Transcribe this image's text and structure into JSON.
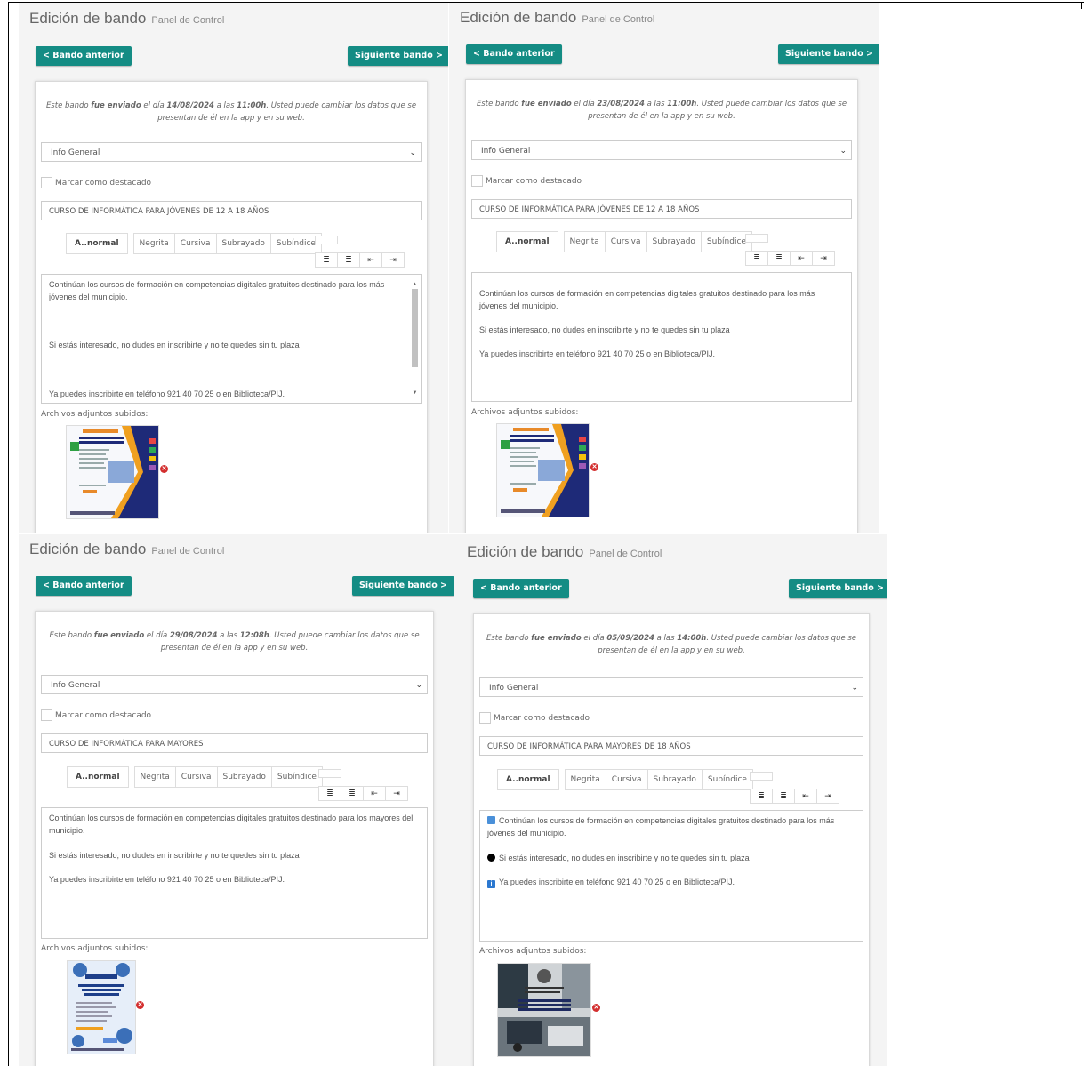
{
  "panels": [
    {
      "title": "Edición de bando",
      "subtitle": "Panel de Control",
      "prev_label": "< Bando anterior",
      "next_label": "Siguiente bando >",
      "notice_pre": "Este bando ",
      "notice_sent": "fue enviado",
      "notice_mid": " el día ",
      "notice_date": "14/08/2024",
      "notice_mid2": " a las ",
      "notice_time": "11:00h",
      "notice_post": ". Usted puede cambiar los datos que se presentan de él en la app y en su web.",
      "category": "Info General",
      "featured_label": "Marcar como destacado",
      "bando_title": "CURSO DE INFORMÁTICA PARA JÓVENES DE 12 A 18 AÑOS",
      "toolbar": {
        "font": "A..normal",
        "bold": "Negrita",
        "italic": "Cursiva",
        "underline": "Subrayado",
        "subscript": "Subíndice"
      },
      "body": [
        "Continúan los cursos de formación en competencias digitales gratuitos destinado para los más jóvenes del municipio.",
        "Si estás interesado, no dudes en inscribirte y no te quedes sin tu plaza",
        "Ya puedes inscribirte en teléfono 921 40 70 25 o en Biblioteca/PIJ."
      ],
      "attachments_label": "Archivos adjuntos subidos:",
      "poster_heading": "NUEVO CENTRO DE CAPACITACIÓN DIGITAL"
    },
    {
      "title": "Edición de bando",
      "subtitle": "Panel de Control",
      "prev_label": "< Bando anterior",
      "next_label": "Siguiente bando >",
      "notice_pre": "Este bando ",
      "notice_sent": "fue enviado",
      "notice_mid": " el día ",
      "notice_date": "23/08/2024",
      "notice_mid2": " a las ",
      "notice_time": "11:00h",
      "notice_post": ". Usted puede cambiar los datos que se presentan de él en la app y en su web.",
      "category": "Info General",
      "featured_label": "Marcar como destacado",
      "bando_title": "CURSO DE INFORMÁTICA PARA JÓVENES DE 12 A 18 AÑOS",
      "toolbar": {
        "font": "A..normal",
        "bold": "Negrita",
        "italic": "Cursiva",
        "underline": "Subrayado",
        "subscript": "Subíndice"
      },
      "body": [
        "Continúan los cursos de formación en competencias digitales gratuitos destinado para los más jóvenes del municipio.",
        "Si estás interesado, no dudes en inscribirte y no te quedes sin tu plaza",
        "Ya puedes inscribirte en teléfono 921 40 70 25 o en Biblioteca/PIJ."
      ],
      "attachments_label": "Archivos adjuntos subidos:",
      "poster_heading": "NUEVO CENTRO DE CAPACITACIÓN DIGITAL"
    },
    {
      "title": "Edición de bando",
      "subtitle": "Panel de Control",
      "prev_label": "< Bando anterior",
      "next_label": "Siguiente bando >",
      "notice_pre": "Este bando ",
      "notice_sent": "fue enviado",
      "notice_mid": " el día ",
      "notice_date": "29/08/2024",
      "notice_mid2": " a las ",
      "notice_time": "12:08h",
      "notice_post": ". Usted puede cambiar los datos que se presentan de él en la app y en su web.",
      "category": "Info General",
      "featured_label": "Marcar como destacado",
      "bando_title": "CURSO DE INFORMÁTICA PARA MAYORES",
      "toolbar": {
        "font": "A..normal",
        "bold": "Negrita",
        "italic": "Cursiva",
        "underline": "Subrayado",
        "subscript": "Subíndice"
      },
      "body": [
        "Continúan los cursos de formación en competencias digitales gratuitos destinado para los mayores del municipio.",
        "Si estás interesado, no dudes en inscribirte y no te quedes sin tu plaza",
        "Ya puedes inscribirte en teléfono 921 40 70 25 o en Biblioteca/PIJ."
      ],
      "attachments_label": "Archivos adjuntos subidos:",
      "poster_heading": "NUEVO CENTRO DE CAPACITACIÓN DIGITAL"
    },
    {
      "title": "Edición de bando",
      "subtitle": "Panel de Control",
      "prev_label": "< Bando anterior",
      "next_label": "Siguiente bando >",
      "notice_pre": "Este bando ",
      "notice_sent": "fue enviado",
      "notice_mid": " el día ",
      "notice_date": "05/09/2024",
      "notice_mid2": " a las ",
      "notice_time": "14:00h",
      "notice_post": ". Usted puede cambiar los datos que se presentan de él en la app y en su web.",
      "category": "Info General",
      "featured_label": "Marcar como destacado",
      "bando_title": "CURSO DE INFORMÁTICA PARA MAYORES DE 18 AÑOS",
      "toolbar": {
        "font": "A..normal",
        "bold": "Negrita",
        "italic": "Cursiva",
        "underline": "Subrayado",
        "subscript": "Subíndice"
      },
      "body": [
        "Continúan los cursos de formación en competencias digitales gratuitos destinado para los más jóvenes del municipio.",
        "Si estás interesado, no dudes en inscribirte y no te quedes sin tu plaza",
        "Ya puedes inscribirte en teléfono 921 40 70 25 o en Biblioteca/PIJ."
      ],
      "body_icons": [
        "laptop-icon",
        "black-circle-icon",
        "info-icon"
      ],
      "attachments_label": "Archivos adjuntos subidos:",
      "poster_heading": "SAN CRISTÓBAL DE SEGOVIA NUEVO CENTRO DE CAPACITACIÓN DIGITAL"
    }
  ],
  "colors": {
    "accent": "#148c84",
    "remove": "#d32f2f",
    "panel_bg": "#f4f4f4"
  }
}
